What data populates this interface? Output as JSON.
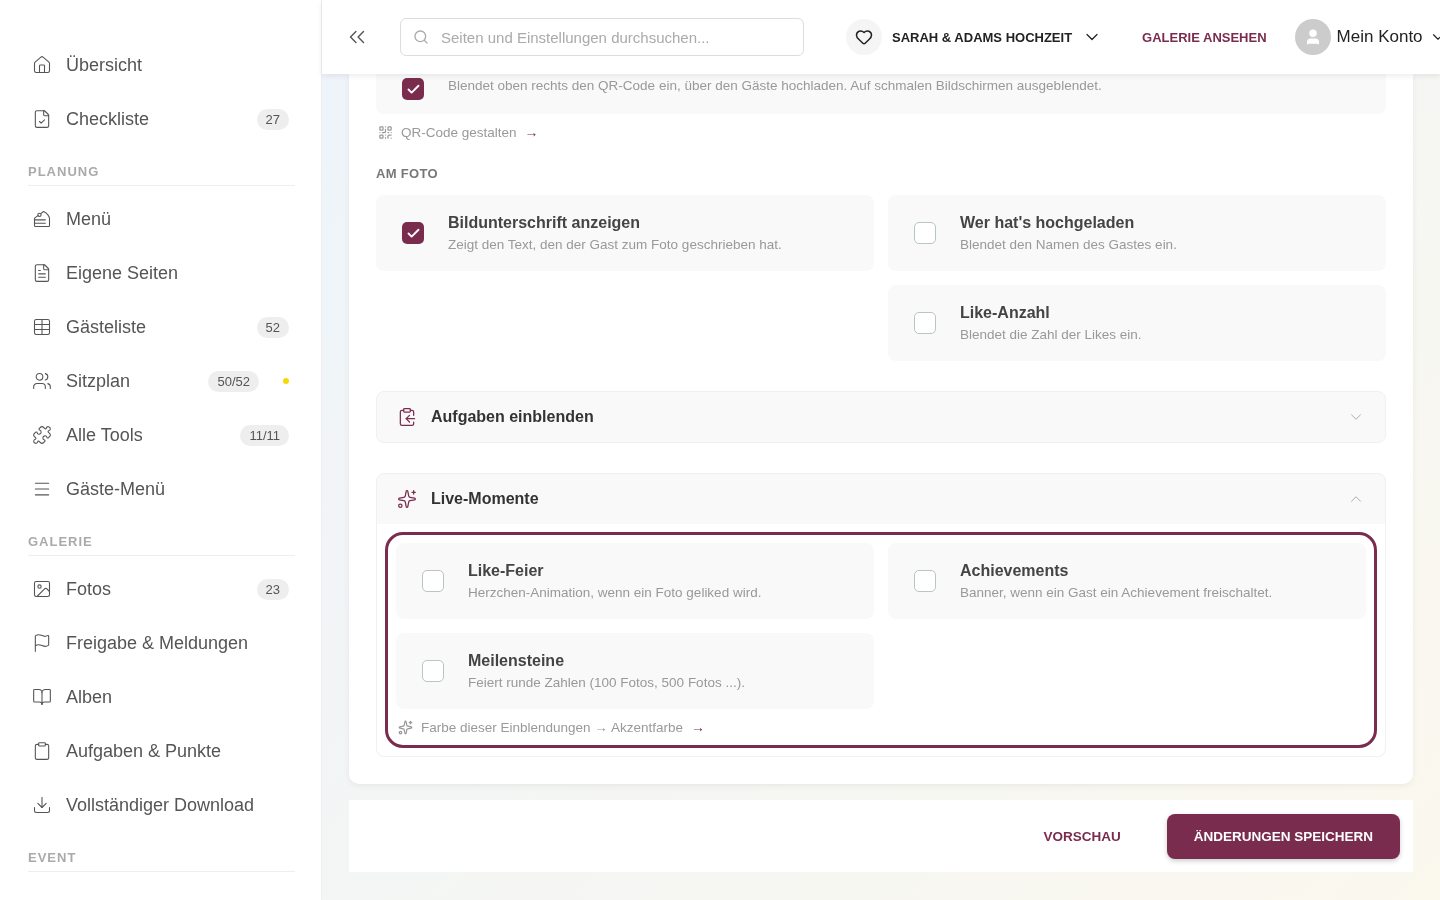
{
  "sidebar": {
    "groups": [
      {
        "items": [
          {
            "label": "Übersicht",
            "selected": false
          },
          {
            "label": "Checkliste",
            "badge": "27",
            "selected": false
          }
        ]
      },
      {
        "title": "PLANUNG",
        "items": [
          {
            "label": "Menü",
            "selected": false
          },
          {
            "label": "Eigene Seiten",
            "selected": false
          },
          {
            "label": "Gästeliste",
            "badge": "52",
            "selected": false
          },
          {
            "label": "Sitzplan",
            "badge": "50/52",
            "color": "#f5d90a",
            "selected": false
          },
          {
            "label": "Alle Tools",
            "badge": "11/11",
            "selected": false
          },
          {
            "label": "Gäste-Menü",
            "selected": false
          }
        ]
      },
      {
        "title": "GALERIE",
        "items": [
          {
            "label": "Fotos",
            "badge": "23",
            "selected": false
          },
          {
            "label": "Freigabe & Meldungen",
            "selected": false
          },
          {
            "label": "Alben",
            "selected": false
          },
          {
            "label": "Aufgaben & Punkte",
            "selected": false
          },
          {
            "label": "Vollständiger Download",
            "selected": false
          }
        ]
      },
      {
        "title": "EVENT"
      }
    ]
  },
  "header": {
    "search": {
      "placeholder": "Seiten und Einstellungen durchsuchen..."
    },
    "event": "SARAH & ADAMS HOCHZEIT",
    "gallery_link": "GALERIE ANSEHEN",
    "account": "Mein Konto"
  },
  "top_setting": {
    "checked": true,
    "description": "Blendet oben rechts den QR-Code ein, über den Gäste hochladen. Auf schmalen Bildschirmen ausgeblendet."
  },
  "qr_link": {
    "label": "QR-Code gestalten",
    "arrow": "→"
  },
  "photo_section": {
    "title": "AM FOTO",
    "columns": [
      [
        {
          "title": "Bildunterschrift anzeigen",
          "description": "Zeigt den Text, den der Gast zum Foto geschrieben hat.",
          "checked": true
        }
      ],
      [
        {
          "title": "Wer hat's hochgeladen",
          "description": "Blendet den Namen des Gastes ein.",
          "checked": false
        },
        {
          "title": "Like-Anzahl",
          "description": "Blendet die Zahl der Likes ein.",
          "checked": false
        }
      ]
    ]
  },
  "accordions": [
    {
      "title": "Aufgaben einblenden",
      "expanded": false
    },
    {
      "title": "Live-Momente",
      "expanded": true,
      "options": [
        {
          "title": "Like-Feier",
          "description": "Herzchen-Animation, wenn ein Foto geliked wird.",
          "checked": false
        },
        {
          "title": "Achievements",
          "description": "Banner, wenn ein Gast ein Achievement freischaltet.",
          "checked": false
        },
        {
          "title": "Meilensteine",
          "description": "Feiert runde Zahlen (100 Fotos, 500 Fotos ...).",
          "checked": false
        }
      ],
      "color_link": {
        "label": "Farbe dieser Einblendungen → Akzentfarbe",
        "arrow": "→"
      }
    }
  ],
  "footer": {
    "preview": "VORSCHAU",
    "save": "ÄNDERUNGEN SPEICHERN"
  }
}
